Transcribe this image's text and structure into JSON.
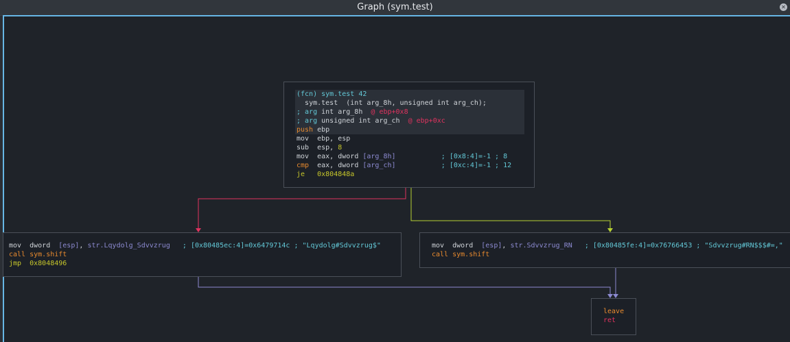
{
  "window": {
    "title": "Graph (sym.test)"
  },
  "colors": {
    "cyan": "#63c8d7",
    "pink": "#e1335f",
    "orange": "#e88a2e",
    "yellow": "#c7c72b",
    "purple": "#8c8ad1",
    "text": "#cfd3d8",
    "border_accent": "#67b7e6",
    "edge_false": "#e1335f",
    "edge_true": "#b7d233",
    "edge_unconditional": "#8c8ad1"
  },
  "icons": {
    "close": "close-icon"
  },
  "nodes": {
    "entry": {
      "fcn_kw": "(fcn)",
      "fcn_name": "sym.test",
      "fcn_size": "42",
      "signature": "sym.test  (int arg_8h, unsigned int arg_ch);",
      "arg1_kw": "; arg",
      "arg1_type": "int arg_8h",
      "arg1_loc": "@ ebp+0x8",
      "arg2_kw": "; arg",
      "arg2_type": "unsigned int arg_ch",
      "arg2_loc": "@ ebp+0xc",
      "l1_op": "push",
      "l1_args": "ebp",
      "l2_op": "mov",
      "l2_a": "ebp",
      "l2_c": ",",
      "l2_b": "esp",
      "l3_op": "sub",
      "l3_a": "esp",
      "l3_c": ",",
      "l3_b": "8",
      "l4_op": "mov",
      "l4_a": "eax",
      "l4_c": ",",
      "l4_b": "dword",
      "l4_mem": "[arg_8h]",
      "l4_comment": "; [0x8:4]=-1 ; 8",
      "l5_op": "cmp",
      "l5_a": "eax",
      "l5_c": ",",
      "l5_b": "dword",
      "l5_mem": "[arg_ch]",
      "l5_comment": "; [0xc:4]=-1 ; 12",
      "l6_op": "je",
      "l6_target": "0x804848a"
    },
    "left": {
      "l1_op": "mov",
      "l1_a": "dword",
      "l1_mem": "[esp]",
      "l1_c": ",",
      "l1_str": "str.Lqydolg_Sdvvzrug",
      "l1_comment": "; [0x80485ec:4]=0x6479714c ; \"Lqydolg#Sdvvzrug$\"",
      "l2_op": "call",
      "l2_target": "sym.shift",
      "l3_op": "jmp",
      "l3_target": "0x8048496"
    },
    "right": {
      "l1_op": "mov",
      "l1_a": "dword",
      "l1_mem": "[esp]",
      "l1_c": ",",
      "l1_str": "str.Sdvvzrug_RN",
      "l1_comment": "; [0x80485fe:4]=0x76766453 ; \"Sdvvzrug#RN$$$#=,\"",
      "l2_op": "call",
      "l2_target": "sym.shift"
    },
    "exit": {
      "l1_op": "leave",
      "l2_op": "ret"
    }
  }
}
